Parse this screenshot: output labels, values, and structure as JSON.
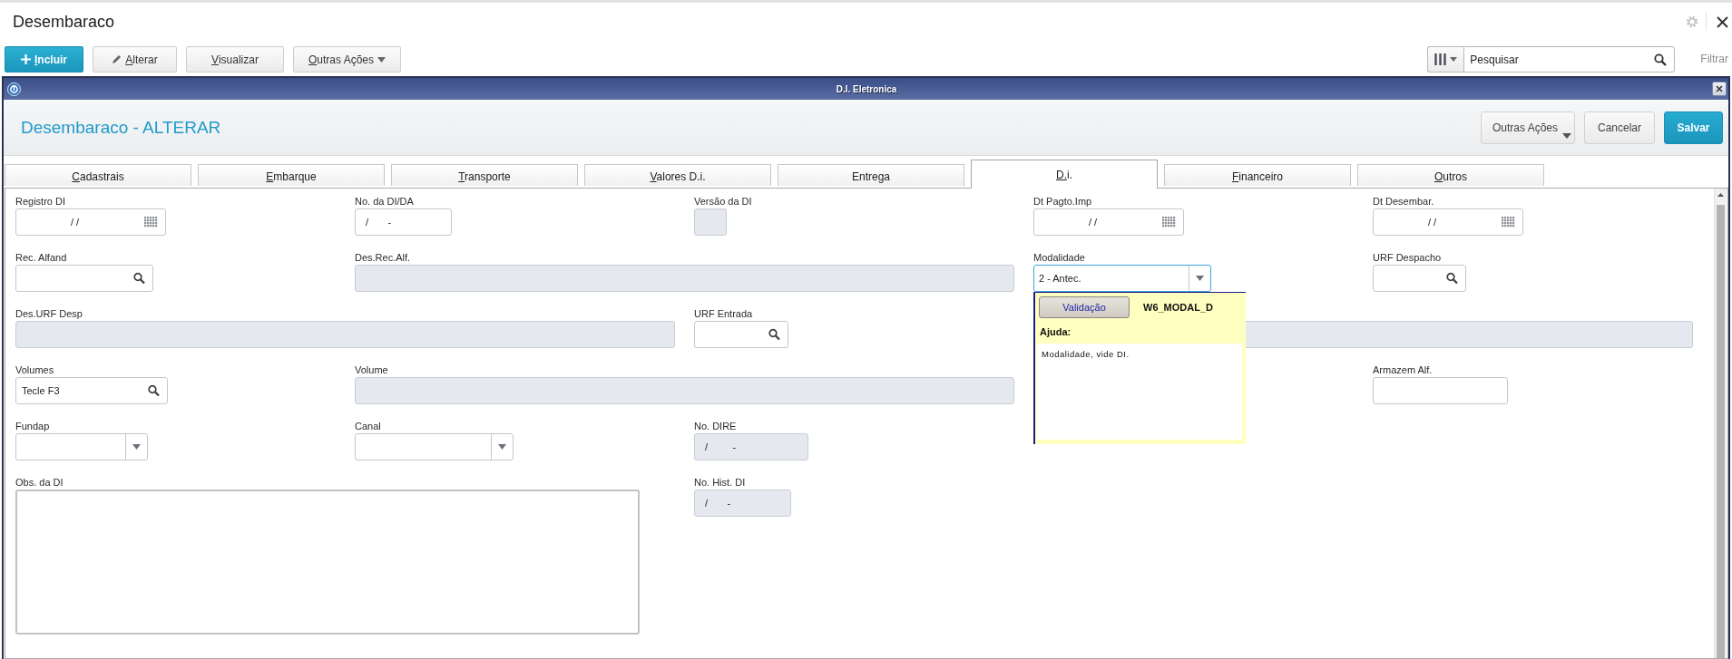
{
  "page": {
    "title": "Desembaraco"
  },
  "toolbar": {
    "buttons": [
      {
        "label": "Incluir",
        "kind": "add"
      },
      {
        "label": "Alterar",
        "kind": "edit"
      },
      {
        "label": "Visualizar",
        "kind": "plain"
      },
      {
        "label": "Outras Ações",
        "kind": "menu"
      }
    ],
    "search": {
      "placeholder": "Pesquisar"
    },
    "filter_link": "Filtrar"
  },
  "window": {
    "title": "D.I. Eletronica",
    "heading": "Desembaraco - ALTERAR",
    "buttons": [
      {
        "label": "Outras Ações",
        "kind": "menu"
      },
      {
        "label": "Cancelar",
        "kind": "plain"
      },
      {
        "label": "Salvar",
        "kind": "primary"
      }
    ]
  },
  "tabs": [
    {
      "label": "Cadastrais",
      "selected": false
    },
    {
      "label": "Embarque",
      "selected": false
    },
    {
      "label": "Transporte",
      "selected": false
    },
    {
      "label": "Valores D.i.",
      "selected": false
    },
    {
      "label": "Entrega",
      "selected": false
    },
    {
      "label": "D.i.",
      "selected": true
    },
    {
      "label": "Financeiro",
      "selected": false
    },
    {
      "label": "Outros",
      "selected": false
    }
  ],
  "form": {
    "rows": [
      [
        {
          "label": "Registro DI",
          "kind": "date",
          "value": "/ /",
          "disabled": false,
          "focused": false
        },
        {
          "label": "No. da DI/DA",
          "kind": "text",
          "value": "/       -",
          "disabled": false,
          "focused": false
        },
        {
          "label": "Versão da DI",
          "kind": "text",
          "disabled": true,
          "focused": false
        },
        {
          "label": "Dt Pagto.Imp",
          "kind": "date",
          "value": "/ /",
          "disabled": false,
          "focused": false
        },
        {
          "label": "Dt Desembar.",
          "kind": "date",
          "value": "/ /",
          "disabled": false,
          "focused": false
        }
      ],
      [
        {
          "label": "Rec. Alfand",
          "kind": "lookup",
          "disabled": false,
          "focused": false
        },
        {
          "label": "Des.Rec.Alf.",
          "kind": "text",
          "disabled": true,
          "focused": false
        },
        "",
        {
          "label": "Modalidade",
          "kind": "select",
          "value": "2 - Antec.",
          "disabled": false,
          "focused": true
        },
        {
          "label": "URF Despacho",
          "kind": "lookup",
          "disabled": false,
          "focused": false
        }
      ],
      [
        {
          "label": "Des.URF Desp",
          "kind": "text",
          "disabled": true,
          "focused": false
        },
        "",
        {
          "label": "URF Entrada",
          "kind": "lookup",
          "disabled": false,
          "focused": false
        },
        {
          "kind": "text",
          "disabled": true,
          "focused": false
        },
        ""
      ],
      [
        {
          "label": "Volumes",
          "kind": "lookup",
          "value": "Tecle F3",
          "disabled": false,
          "focused": false
        },
        {
          "label": "Volume",
          "kind": "text",
          "disabled": true,
          "focused": false
        },
        "",
        "",
        {
          "label": "Armazem Alf.",
          "kind": "text",
          "disabled": false,
          "focused": false
        }
      ],
      [
        {
          "label": "Fundap",
          "kind": "select",
          "disabled": false,
          "focused": false
        },
        {
          "label": "Canal",
          "kind": "select",
          "disabled": false,
          "focused": false
        },
        {
          "label": "No. DIRE",
          "kind": "text",
          "value": "/         -",
          "disabled": true,
          "focused": false
        }
      ],
      [
        {
          "label": "Obs. da DI",
          "kind": "textarea",
          "disabled": false,
          "focused": false
        },
        "",
        {
          "label": "No. Hist. DI",
          "kind": "text",
          "value": "/       -",
          "disabled": true,
          "focused": false
        }
      ]
    ]
  },
  "help_popup": {
    "button": "Validação",
    "field_code": "W6_MODAL_D",
    "heading": "Ajuda:",
    "text": "Modalidade, vide DI."
  }
}
